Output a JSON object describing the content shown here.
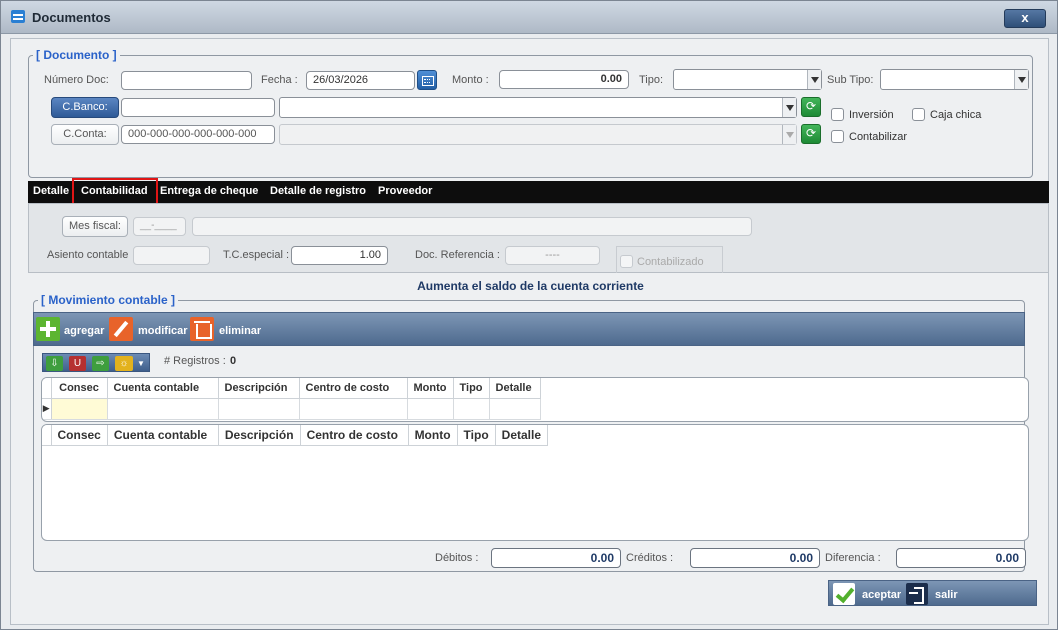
{
  "window": {
    "title": "Documentos",
    "close_label": "x"
  },
  "documento": {
    "legend": "[ Documento ]",
    "numero_doc_label": "Número Doc:",
    "numero_doc_value": "",
    "fecha_label": "Fecha :",
    "fecha_value": "26/03/2026",
    "monto_label": "Monto :",
    "monto_value": "0.00",
    "tipo_label": "Tipo:",
    "subtipo_label": "Sub Tipo:",
    "cbanco_label": "C.Banco:",
    "cbanco_value": "",
    "cconta_label": "C.Conta:",
    "cconta_value": "000-000-000-000-000-000",
    "inversion_label": "Inversión",
    "caja_chica_label": "Caja chica",
    "contabilizar_label": "Contabilizar"
  },
  "tabs": [
    {
      "label": "Detalle"
    },
    {
      "label": "Contabilidad"
    },
    {
      "label": "Entrega de cheque"
    },
    {
      "label": "Detalle de registro"
    },
    {
      "label": "Proveedor"
    }
  ],
  "contabilidad": {
    "mes_fiscal_label": "Mes fiscal:",
    "mes_fiscal_value": "__-____",
    "asiento_label": "Asiento contable",
    "tc_label": "T.C.especial :",
    "tc_value": "1.00",
    "doc_ref_label": "Doc. Referencia :",
    "doc_ref_value": "----",
    "contabilizado_label": "Contabilizado"
  },
  "banner": "Aumenta el saldo de la cuenta corriente",
  "movimiento": {
    "legend": "[ Movimiento contable ]",
    "agregar": "agregar",
    "modificar": "modificar",
    "eliminar": "eliminar",
    "registros_label": "# Registros :",
    "registros_count": "0",
    "columns": [
      "Consec",
      "Cuenta contable",
      "Descripción",
      "Centro de costo",
      "Monto",
      "Tipo",
      "Detalle"
    ]
  },
  "totals": {
    "debitos_label": "Débitos :",
    "debitos_value": "0.00",
    "creditos_label": "Créditos :",
    "creditos_value": "0.00",
    "diferencia_label": "Diferencia :",
    "diferencia_value": "0.00"
  },
  "footer": {
    "aceptar": "aceptar",
    "salir": "salir"
  },
  "colors": {
    "legend_blue": "#2a62c9",
    "toolbar": "#5b759a",
    "tab_bar": "#0d0d0d",
    "highlight": "#e01515"
  }
}
